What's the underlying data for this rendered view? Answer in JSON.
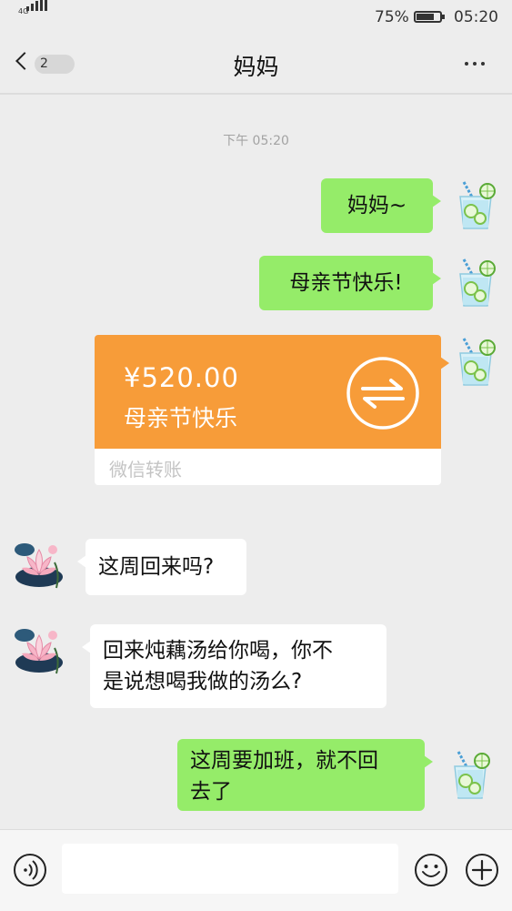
{
  "status_bar": {
    "network": "4G",
    "battery_percent": "75%",
    "battery_level": 0.75,
    "time": "05:20"
  },
  "nav": {
    "unread_count": "2",
    "title": "妈妈",
    "back_icon": "chevron-left-icon",
    "more_icon": "more-dots-icon"
  },
  "chat": {
    "timestamp": "下午 05:20",
    "messages": [
      {
        "from": "me",
        "text": "妈妈~"
      },
      {
        "from": "me",
        "text": "母亲节快乐!"
      },
      {
        "from": "me",
        "type": "transfer",
        "amount": "¥520.00",
        "note": "母亲节快乐",
        "label": "微信转账",
        "icon": "transfer-arrows-icon"
      },
      {
        "from": "them",
        "text": "这周回来吗?"
      },
      {
        "from": "them",
        "line1": "回来炖藕汤给你喝，你不",
        "line2": "是说想喝我做的汤么?"
      },
      {
        "from": "me",
        "line1": "这周要加班，就不回",
        "line2": "去了"
      }
    ]
  },
  "input_bar": {
    "placeholder": "",
    "voice_icon": "voice-icon",
    "emoji_icon": "emoji-icon",
    "plus_icon": "plus-icon"
  },
  "colors": {
    "my_bubble": "#95ec69",
    "their_bubble": "#ffffff",
    "transfer": "#f79c39",
    "background": "#ededed"
  }
}
